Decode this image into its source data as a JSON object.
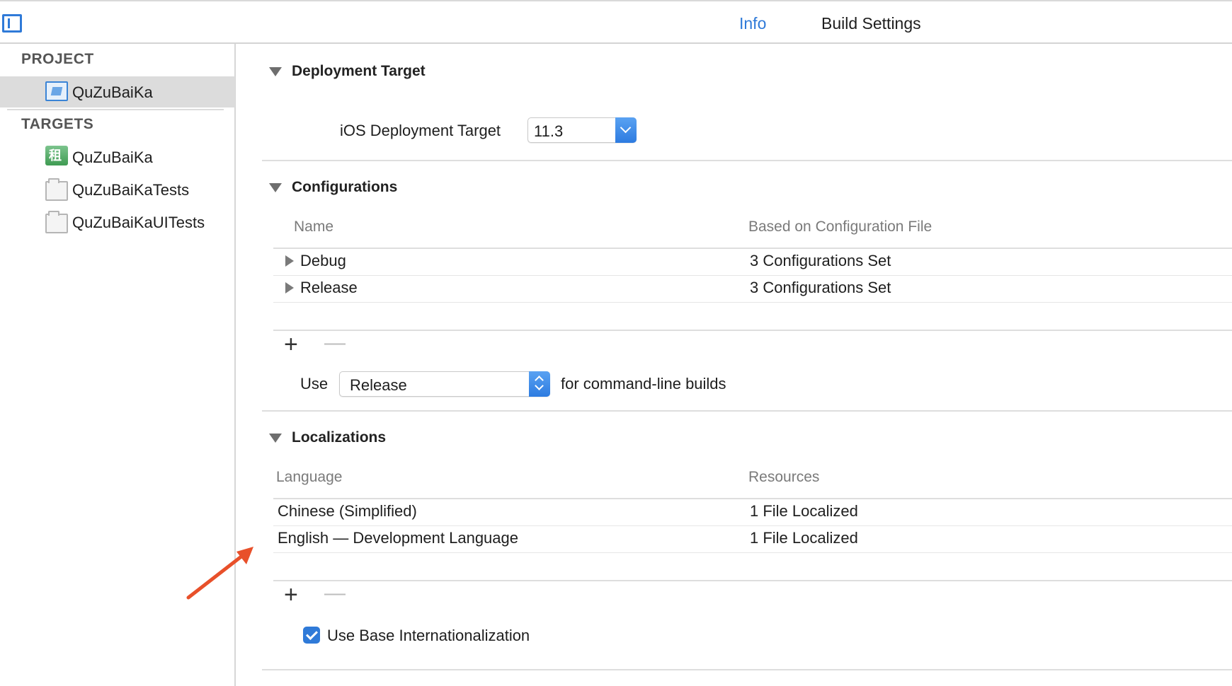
{
  "header": {
    "tabs": [
      {
        "label": "Info",
        "active": true
      },
      {
        "label": "Build Settings",
        "active": false
      }
    ],
    "accent_color": "#2f7ad8"
  },
  "sidebar": {
    "project_heading": "PROJECT",
    "project_items": [
      {
        "label": "QuZuBaiKa",
        "icon": "project-file-icon",
        "selected": true
      }
    ],
    "targets_heading": "TARGETS",
    "target_items": [
      {
        "label": "QuZuBaiKa",
        "icon": "app-target-icon"
      },
      {
        "label": "QuZuBaiKaTests",
        "icon": "test-bundle-icon"
      },
      {
        "label": "QuZuBaiKaUITests",
        "icon": "test-bundle-icon"
      }
    ]
  },
  "deployment": {
    "title": "Deployment Target",
    "ios_label": "iOS Deployment Target",
    "ios_value": "11.3"
  },
  "configurations": {
    "title": "Configurations",
    "columns": [
      "Name",
      "Based on Configuration File"
    ],
    "rows": [
      {
        "name": "Debug",
        "file": "3 Configurations Set"
      },
      {
        "name": "Release",
        "file": "3 Configurations Set"
      }
    ],
    "add_label": "+",
    "remove_label": "—",
    "use_label": "Use",
    "use_value": "Release",
    "suffix": "for command-line builds"
  },
  "localizations": {
    "title": "Localizations",
    "columns": [
      "Language",
      "Resources"
    ],
    "rows": [
      {
        "language": "Chinese (Simplified)",
        "resources": "1 File Localized"
      },
      {
        "language": "English — Development Language",
        "resources": "1 File Localized"
      }
    ],
    "add_label": "+",
    "remove_label": "—",
    "base_intl_label": "Use Base Internationalization",
    "base_intl_checked": true
  },
  "annotation": {
    "arrow_color": "#e8502a"
  }
}
